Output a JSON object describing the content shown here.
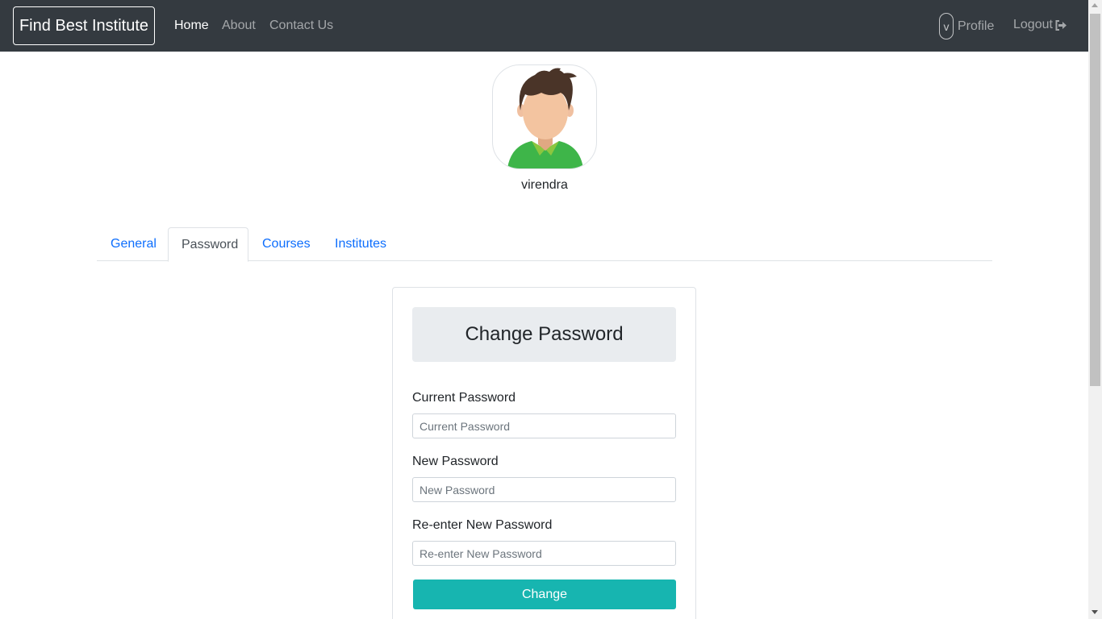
{
  "navbar": {
    "brand": "Find Best Institute",
    "links": [
      "Home",
      "About",
      "Contact Us"
    ],
    "avatar_initial": "v",
    "profile_label": "Profile",
    "logout_label": "Logout"
  },
  "profile": {
    "username": "virendra"
  },
  "tabs": [
    "General",
    "Password",
    "Courses",
    "Institutes"
  ],
  "active_tab": "Password",
  "form": {
    "title": "Change Password",
    "fields": [
      {
        "label": "Current Password",
        "placeholder": "Current Password",
        "value": ""
      },
      {
        "label": "New Password",
        "placeholder": "New Password",
        "value": ""
      },
      {
        "label": "Re-enter New Password",
        "placeholder": "Re-enter New Password",
        "value": ""
      }
    ],
    "submit_label": "Change"
  },
  "colors": {
    "navbar_bg": "#343a40",
    "link_blue": "#0d6efd",
    "button_teal": "#17b5b0",
    "header_bg": "#e9ecef"
  },
  "icons": [
    "logout-icon",
    "user-avatar-icon"
  ]
}
